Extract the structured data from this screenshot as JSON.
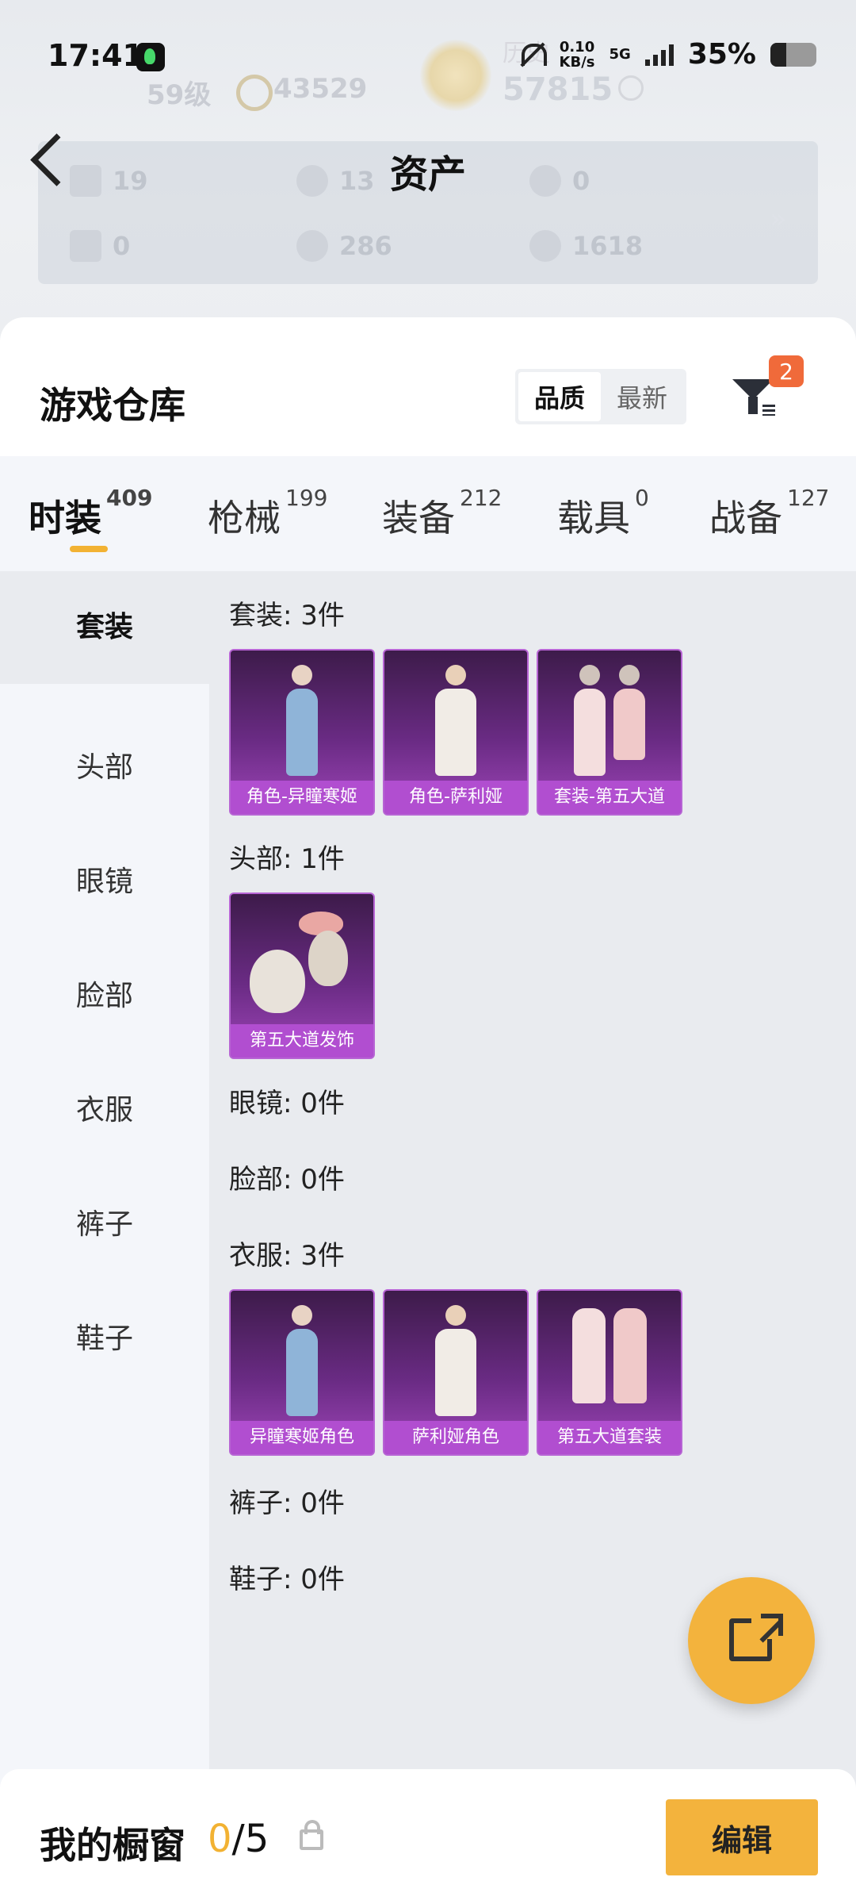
{
  "status_bar": {
    "time": "17:41",
    "speed": "0.10",
    "speed_unit": "KB/s",
    "network": "5G",
    "battery_percent": "35%",
    "battery_level": 0.35
  },
  "header": {
    "title": "资产",
    "faded": {
      "level": "59级",
      "points": "43529",
      "history_label": "历史",
      "history_value": "57815"
    },
    "assets": [
      {
        "value": "19"
      },
      {
        "value": "13"
      },
      {
        "value": "0"
      },
      {
        "value": "0"
      },
      {
        "value": "286"
      },
      {
        "value": "1618"
      }
    ],
    "more_icon": "double-chevron-right-icon"
  },
  "warehouse": {
    "title": "游戏仓库",
    "sort_options": [
      "品质",
      "最新"
    ],
    "active_sort": "品质",
    "filter_badge": "2"
  },
  "tabs": [
    {
      "label": "时装",
      "count": "409"
    },
    {
      "label": "枪械",
      "count": "199"
    },
    {
      "label": "装备",
      "count": "212"
    },
    {
      "label": "载具",
      "count": "0"
    },
    {
      "label": "战备",
      "count": "127"
    }
  ],
  "categories": [
    "套装",
    "头部",
    "眼镜",
    "脸部",
    "衣服",
    "裤子",
    "鞋子"
  ],
  "sections": [
    {
      "title": "套装: 3件",
      "items": [
        "角色-异瞳寒姬",
        "角色-萨利娅",
        "套装-第五大道"
      ]
    },
    {
      "title": "头部: 1件",
      "items": [
        "第五大道发饰"
      ]
    },
    {
      "title": "眼镜: 0件",
      "items": []
    },
    {
      "title": "脸部: 0件",
      "items": []
    },
    {
      "title": "衣服: 3件",
      "items": [
        "异瞳寒姬角色",
        "萨利娅角色",
        "第五大道套装"
      ]
    },
    {
      "title": "裤子: 0件",
      "items": []
    },
    {
      "title": "鞋子: 0件",
      "items": []
    }
  ],
  "showcase": {
    "label": "我的橱窗",
    "current": "0",
    "total": "/5",
    "edit_label": "编辑"
  },
  "colors": {
    "accent": "#f3b33d",
    "card_purple": "#6a2b84",
    "card_label": "#b14ed0",
    "badge": "#f06a3a"
  }
}
